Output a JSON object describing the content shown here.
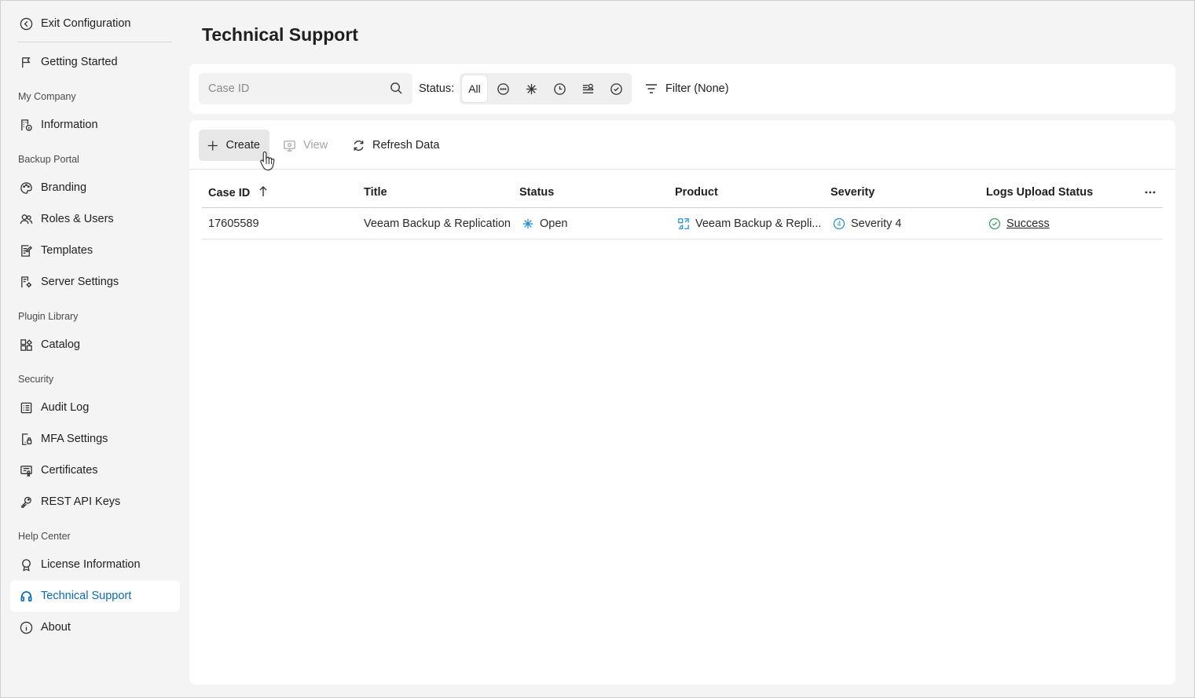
{
  "sidebar": {
    "exit": "Exit Configuration",
    "getting_started": "Getting Started",
    "sections": {
      "my_company": "My Company",
      "backup_portal": "Backup Portal",
      "plugin_library": "Plugin Library",
      "security": "Security",
      "help_center": "Help Center"
    },
    "items": {
      "information": "Information",
      "branding": "Branding",
      "roles_users": "Roles & Users",
      "templates": "Templates",
      "server_settings": "Server Settings",
      "catalog": "Catalog",
      "audit_log": "Audit Log",
      "mfa_settings": "MFA Settings",
      "certificates": "Certificates",
      "rest_api_keys": "REST API Keys",
      "license_information": "License Information",
      "technical_support": "Technical Support",
      "about": "About"
    },
    "active_item": "technical_support",
    "active_color": "#0b6bb8"
  },
  "page": {
    "title": "Technical Support"
  },
  "filters": {
    "search_placeholder": "Case ID",
    "status_label": "Status:",
    "status_options": [
      {
        "label": "All",
        "selected": true
      },
      {
        "icon": "ellipsis-circle-icon"
      },
      {
        "icon": "asterisk-icon"
      },
      {
        "icon": "clock-icon"
      },
      {
        "icon": "waiting-person-icon"
      },
      {
        "icon": "check-circle-icon"
      }
    ],
    "filter_button": "Filter (None)"
  },
  "toolbar": {
    "create": "Create",
    "view": "View",
    "refresh": "Refresh Data"
  },
  "table": {
    "columns": [
      "Case ID",
      "Title",
      "Status",
      "Product",
      "Severity",
      "Logs Upload Status"
    ],
    "sort_column": "Case ID",
    "sort_direction": "ascending",
    "rows": [
      {
        "case_id": "17605589",
        "title": "Veeam Backup & Replication",
        "status": "Open",
        "product": "Veeam Backup & Repli...",
        "severity": "Severity 4",
        "severity_level": "4",
        "logs_upload_status": "Success"
      }
    ]
  },
  "colors": {
    "accent": "#0b6bb8",
    "status_open": "#1e8fd6",
    "success": "#2f9e5f"
  }
}
